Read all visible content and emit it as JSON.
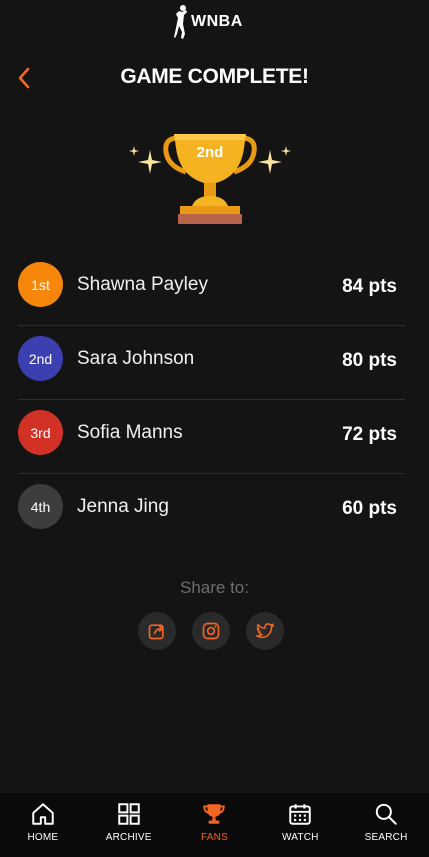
{
  "app": {
    "logo_text": "WNBA"
  },
  "header": {
    "title": "GAME COMPLETE!"
  },
  "trophy": {
    "place_label": "2nd"
  },
  "leaderboard": [
    {
      "rank": "1st",
      "name": "Shawna Payley",
      "points": "84 pts",
      "color": "#f7870a"
    },
    {
      "rank": "2nd",
      "name": "Sara Johnson",
      "points": "80 pts",
      "color": "#3b3fb0"
    },
    {
      "rank": "3rd",
      "name": "Sofia Manns",
      "points": "72 pts",
      "color": "#d23226"
    },
    {
      "rank": "4th",
      "name": "Jenna Jing",
      "points": "60 pts",
      "color": "#3d3d3d"
    }
  ],
  "share": {
    "label": "Share to:",
    "targets": [
      "share-icon",
      "instagram-icon",
      "twitter-icon"
    ]
  },
  "nav": {
    "items": [
      {
        "label": "HOME",
        "icon": "home-icon"
      },
      {
        "label": "ARCHIVE",
        "icon": "archive-icon"
      },
      {
        "label": "FANS",
        "icon": "trophy-icon",
        "active": true
      },
      {
        "label": "WATCH",
        "icon": "calendar-icon"
      },
      {
        "label": "SEARCH",
        "icon": "search-icon"
      }
    ]
  },
  "colors": {
    "accent": "#f26522",
    "background": "#141414",
    "gold": "#f5b221"
  }
}
